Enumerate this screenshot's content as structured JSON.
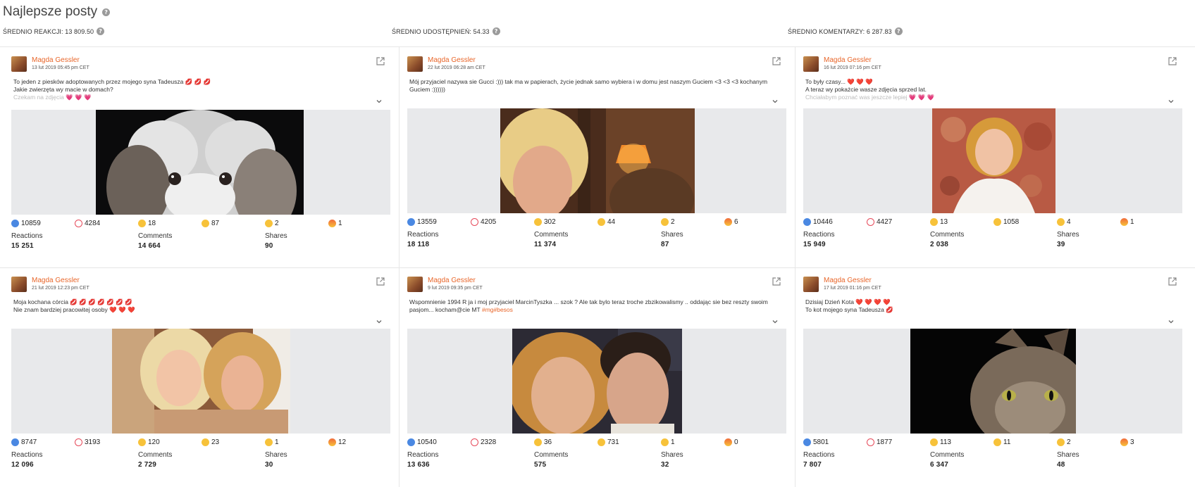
{
  "page": {
    "title": "Najlepsze posty"
  },
  "stats": {
    "reactions": "ŚREDNIO REAKCJI: 13 809.50",
    "shares": "ŚREDNIO UDOSTĘPNIEŃ: 54.33",
    "comments": "ŚREDNIO KOMENTARZY: 6 287.83"
  },
  "labels": {
    "reactions": "Reactions",
    "comments": "Comments",
    "shares": "Shares"
  },
  "posts": [
    {
      "author": "Magda Gessler",
      "date": "13 lut 2019 05:45 pm CET",
      "line1": "To jeden z piesków adoptowanych przez mojego syna Tadeusza 💋 💋 💋",
      "line2": "Jakie zwierzęta wy macie w domach?",
      "line3": "Czekam na zdjęcia 💗 💗 💗",
      "image": "dog",
      "likes": "10859",
      "loves": "4284",
      "haha": "18",
      "wow": "87",
      "sad": "2",
      "angry": "1",
      "reactions_total": "15 251",
      "comments_total": "14 664",
      "shares_total": "90"
    },
    {
      "author": "Magda Gessler",
      "date": "22 lut 2019 06:28 am CET",
      "line1": "Mój przyjaciel nazywa sie Gucci :))) tak ma w papierach, życie jednak samo wybiera i w domu jest naszym Guciem <3 <3 <3 kochanym",
      "line2": "Guciem :))))))",
      "line3": "",
      "image": "selfie",
      "likes": "13559",
      "loves": "4205",
      "haha": "302",
      "wow": "44",
      "sad": "2",
      "angry": "6",
      "reactions_total": "18 118",
      "comments_total": "11 374",
      "shares_total": "87"
    },
    {
      "author": "Magda Gessler",
      "date": "16 lut 2019 07:16 pm CET",
      "line1": "To były czasy... ❤️ ❤️ ❤️",
      "line2": "A teraz wy pokażcie wasze zdjęcia sprzed lat.",
      "line3": "Chciałabym poznać was jeszcze lepiej 💗 💗 💗",
      "image": "portrait",
      "likes": "10446",
      "loves": "4427",
      "haha": "13",
      "wow": "1058",
      "sad": "4",
      "angry": "1",
      "reactions_total": "15 949",
      "comments_total": "2 038",
      "shares_total": "39"
    },
    {
      "author": "Magda Gessler",
      "date": "21 lut 2019 12:23 pm CET",
      "line1": "Moja kochana córcia 💋 💋 💋 💋 💋 💋 💋",
      "line2": "Nie znam bardziej pracowitej osoby ❤️ ❤️ ❤️",
      "line3": "",
      "image": "women",
      "likes": "8747",
      "loves": "3193",
      "haha": "120",
      "wow": "23",
      "sad": "1",
      "angry": "12",
      "reactions_total": "12 096",
      "comments_total": "2 729",
      "shares_total": "30"
    },
    {
      "author": "Magda Gessler",
      "date": "9 lut 2019 09:35 pm CET",
      "line1": "Wspomnienie 1994 R ja i moj przyjaciel MarcinTyszka ... szok ? Ale tak bylo teraz troche zbzikowalismy .. oddając sie bez reszty swoim",
      "line2": "pasjom... kocham@cie MT",
      "line2_tag": "#mg#besos",
      "line3": "",
      "image": "couple",
      "likes": "10540",
      "loves": "2328",
      "haha": "36",
      "wow": "731",
      "sad": "1",
      "angry": "0",
      "reactions_total": "13 636",
      "comments_total": "575",
      "shares_total": "32"
    },
    {
      "author": "Magda Gessler",
      "date": "17 lut 2019 01:16 pm CET",
      "line1": "Dzisiaj Dzień Kota ❤️ ❤️ ❤️ ❤️",
      "line2": "To kot mojego syna Tadeusza 💋",
      "line3": "",
      "image": "cat",
      "likes": "5801",
      "loves": "1877",
      "haha": "113",
      "wow": "11",
      "sad": "2",
      "angry": "3",
      "reactions_total": "7 807",
      "comments_total": "6 347",
      "shares_total": "48"
    }
  ]
}
